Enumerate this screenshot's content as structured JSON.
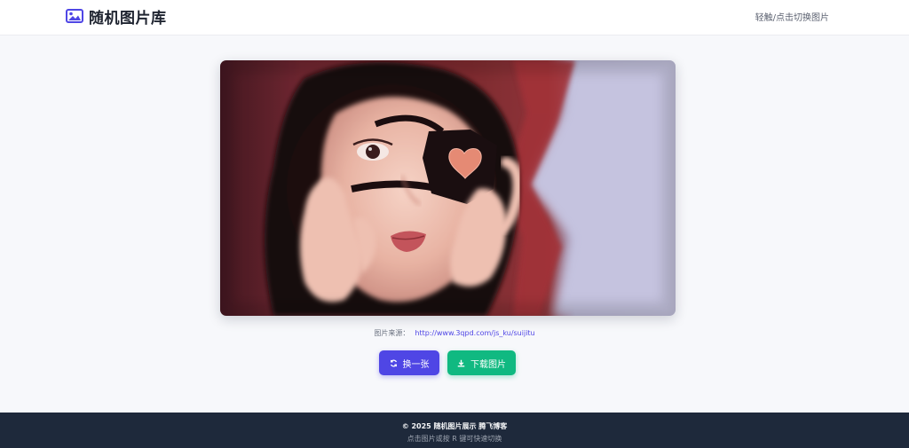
{
  "header": {
    "title": "随机图片库",
    "hint": "轻触/点击切换图片",
    "logo_icon": "image-icon"
  },
  "main": {
    "photo_alt": "随机图片",
    "source_label": "图片来源：",
    "source_url": "http://www.3qpd.com/js_ku/suijitu",
    "buttons": {
      "refresh_label": "换一张",
      "refresh_icon": "refresh-icon",
      "download_label": "下载图片",
      "download_icon": "download-icon"
    }
  },
  "footer": {
    "copyright": "© 2025 随机图片展示 腾飞博客",
    "tip": "点击图片或按 R 键可快速切换"
  },
  "colors": {
    "primary": "#4f46e5",
    "success": "#10b981",
    "footer_bg": "#1e293b",
    "page_bg": "#f7f8fb"
  }
}
